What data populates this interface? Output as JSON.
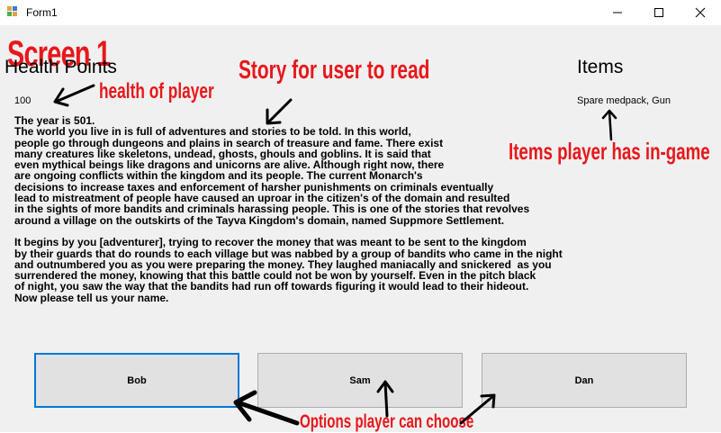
{
  "window": {
    "title": "Form1"
  },
  "screen_label": "Screen 1",
  "health": {
    "heading": "Health Points",
    "value": "100"
  },
  "items": {
    "heading": "Items",
    "value": "Spare medpack, Gun"
  },
  "story_lines": [
    "The year is 501.",
    "The world you live in is full of adventures and stories to be told. In this world,",
    "people go through dungeons and plains in search of treasure and fame. There exist",
    "many creatures like skeletons, undead, ghosts, ghouls and goblins. It is said that",
    "even mythical beings like dragons and unicorns are alive. Although right now, there",
    "are ongoing conflicts within the kingdom and its people. The current Monarch's",
    "decisions to increase taxes and enforcement of harsher punishments on criminals eventually",
    "lead to mistreatment of people have caused an uproar in the citizen's of the domain and resulted",
    "in the sights of more bandits and criminals harassing people. This is one of the stories that revolves",
    "around a village on the outskirts of the Tayva Kingdom's domain, named Suppmore Settlement.",
    "",
    "It begins by you [adventurer], trying to recover the money that was meant to be sent to the kingdom",
    "by their guards that do rounds to each village but was nabbed by a group of bandits who came in the night",
    "and outnumbered you as you were preparing the money. They laughed maniacally and snickered  as you",
    "surrendered the money, knowing that this battle could not be won by yourself. Even in the pitch black",
    "of night, you saw the way that the bandits had run off towards figuring it would lead to their hideout.",
    "Now please tell us your name."
  ],
  "options": {
    "bob": "Bob",
    "sam": "Sam",
    "dan": "Dan"
  },
  "annotations": {
    "health": "health of player",
    "story": "Story for user to read",
    "items": "Items player has in-game",
    "options": "Options player can choose"
  },
  "colors": {
    "annotation": "#e8171b",
    "form_bg": "#f0f0f0",
    "focus_border": "#0078d7"
  },
  "icons": [
    "app-icon",
    "minimize-icon",
    "maximize-icon",
    "close-icon"
  ]
}
